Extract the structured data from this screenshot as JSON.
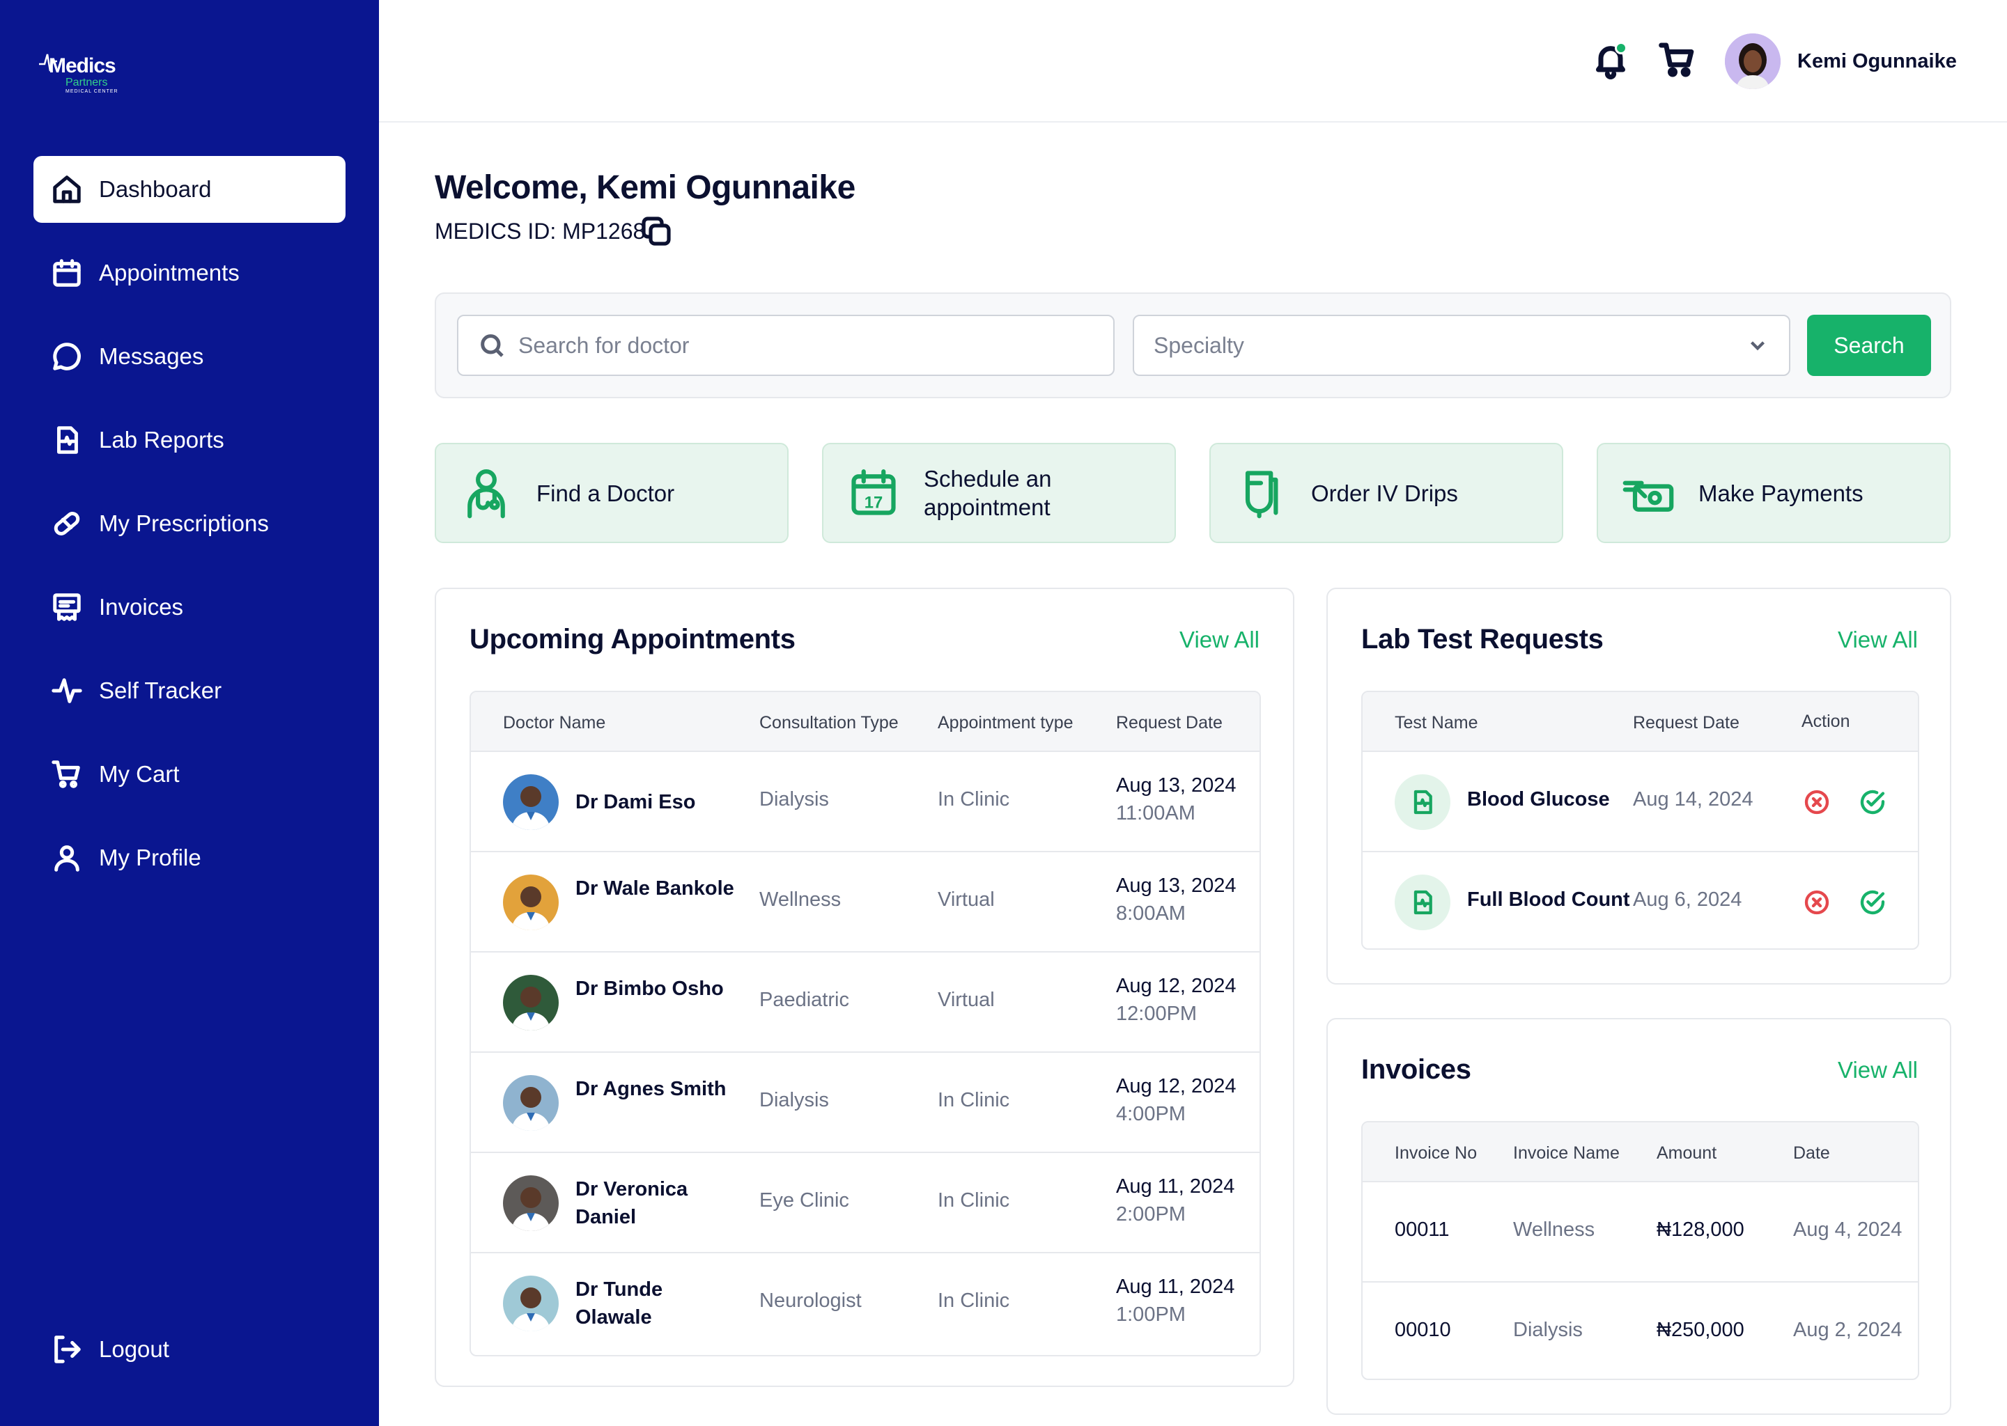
{
  "brand": {
    "logo_main": "Medics",
    "logo_sub": "Partners",
    "logo_tag": "MEDICAL CENTER"
  },
  "sidebar": {
    "items": [
      {
        "label": "Dashboard",
        "icon": "home-icon"
      },
      {
        "label": "Appointments",
        "icon": "calendar-icon"
      },
      {
        "label": "Messages",
        "icon": "message-icon"
      },
      {
        "label": "Lab Reports",
        "icon": "lab-report-icon"
      },
      {
        "label": "My Prescriptions",
        "icon": "pill-icon"
      },
      {
        "label": "Invoices",
        "icon": "invoice-icon"
      },
      {
        "label": "Self Tracker",
        "icon": "activity-icon"
      },
      {
        "label": "My Cart",
        "icon": "cart-icon"
      },
      {
        "label": "My Profile",
        "icon": "user-icon"
      }
    ],
    "logout_label": "Logout"
  },
  "header": {
    "user_name": "Kemi Ogunnaike"
  },
  "main": {
    "welcome": "Welcome, Kemi Ogunnaike",
    "medics_id": "MEDICS ID: MP1268"
  },
  "search": {
    "placeholder": "Search for doctor",
    "specialty_placeholder": "Specialty",
    "button_label": "Search"
  },
  "quick_actions": [
    {
      "label": "Find a Doctor",
      "icon": "doctor-icon"
    },
    {
      "label": "Schedule an appointment",
      "icon": "calendar-17-icon"
    },
    {
      "label": "Order IV Drips",
      "icon": "iv-drip-icon"
    },
    {
      "label": "Make Payments",
      "icon": "payment-icon"
    }
  ],
  "appointments": {
    "title": "Upcoming Appointments",
    "view_all": "View All",
    "columns": [
      "Doctor Name",
      "Consultation Type",
      "Appointment type",
      "Request Date"
    ],
    "rows": [
      {
        "doctor": "Dr Dami Eso",
        "consultation": "Dialysis",
        "type": "In Clinic",
        "date": "Aug 13, 2024",
        "time": "11:00AM",
        "avatar_color": "#3f7fc6"
      },
      {
        "doctor": "Dr Wale Bankole",
        "consultation": "Wellness",
        "type": "Virtual",
        "date": "Aug 13, 2024",
        "time": "8:00AM",
        "avatar_color": "#e2a23b"
      },
      {
        "doctor": "Dr Bimbo Osho",
        "consultation": "Paediatric",
        "type": "Virtual",
        "date": "Aug 12, 2024",
        "time": "12:00PM",
        "avatar_color": "#2f5a3a"
      },
      {
        "doctor": "Dr Agnes Smith",
        "consultation": "Dialysis",
        "type": "In Clinic",
        "date": "Aug 12, 2024",
        "time": "4:00PM",
        "avatar_color": "#8fb3cf"
      },
      {
        "doctor": "Dr Veronica Daniel",
        "consultation": "Eye Clinic",
        "type": "In Clinic",
        "date": "Aug 11, 2024",
        "time": "2:00PM",
        "avatar_color": "#5d5a58"
      },
      {
        "doctor": "Dr Tunde Olawale",
        "consultation": "Neurologist",
        "type": "In Clinic",
        "date": "Aug 11, 2024",
        "time": "1:00PM",
        "avatar_color": "#9fc9d6"
      }
    ]
  },
  "lab_requests": {
    "title": "Lab Test Requests",
    "view_all": "View All",
    "columns": [
      "Test Name",
      "Request Date",
      "Action"
    ],
    "rows": [
      {
        "test": "Blood Glucose",
        "date": "Aug 14, 2024"
      },
      {
        "test": "Full Blood Count",
        "date": "Aug 6, 2024"
      }
    ]
  },
  "invoices": {
    "title": "Invoices",
    "view_all": "View All",
    "columns": [
      "Invoice No",
      "Invoice Name",
      "Amount",
      "Date"
    ],
    "rows": [
      {
        "no": "00011",
        "name": "Wellness",
        "amount": "₦128,000",
        "date": "Aug 4, 2024"
      },
      {
        "no": "00010",
        "name": "Dialysis",
        "amount": "₦250,000",
        "date": "Aug 2, 2024"
      }
    ]
  },
  "colors": {
    "sidebar": "#0a1690",
    "accent": "#17b26a",
    "danger": "#e5484d"
  }
}
